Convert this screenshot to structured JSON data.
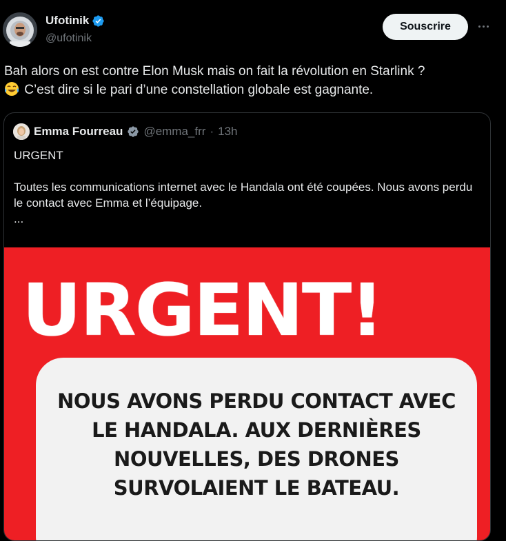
{
  "author": {
    "name": "Ufotinik",
    "handle": "@ufotinik",
    "verified_icon": "verified-badge-icon",
    "verified_color": "#1d9bf0"
  },
  "actions": {
    "subscribe_label": "Souscrire",
    "more_icon": "more-horizontal-icon"
  },
  "tweet": {
    "line1": "Bah alors on est contre Elon Musk mais on fait la révolution en Starlink ?",
    "emoji": "😂",
    "line2": "C’est dire si le pari d’une constellation globale est gagnante."
  },
  "quoted": {
    "name": "Emma Fourreau",
    "handle": "@emma_frr",
    "separator": "·",
    "time": "13h",
    "verified_color": "#8b98a5",
    "body_urgent": "URGENT",
    "body_text": "Toutes les communications internet avec le Handala ont été coupées. Nous avons perdu le contact avec Emma et l’équipage.",
    "body_ellipsis": "...",
    "media": {
      "title": "URGENT!",
      "line1": "NOUS AVONS PERDU CONTACT AVEC",
      "line2": "LE HANDALA. AUX DERNIÈRES",
      "line3": "NOUVELLES, DES DRONES",
      "line4": "SURVOLAIENT LE BATEAU.",
      "background": "#ee1f24"
    }
  }
}
